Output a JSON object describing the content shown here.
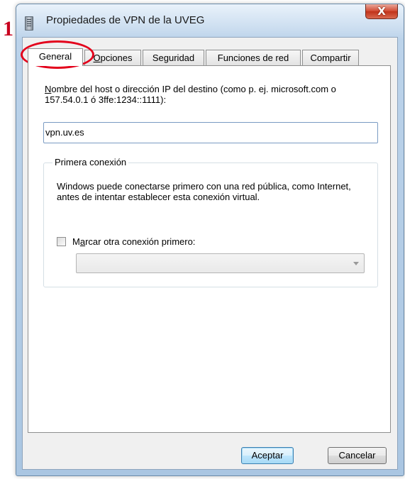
{
  "annotation": {
    "number": "1",
    "color": "#c8001e"
  },
  "window": {
    "title": "Propiedades de VPN de la UVEG",
    "close_glyph": "X"
  },
  "tabs": [
    {
      "label": "General",
      "active": true
    },
    {
      "label_accel": "O",
      "label_rest": "pciones",
      "active": false
    },
    {
      "label": "Seguridad",
      "active": false
    },
    {
      "label": "Funciones de red",
      "active": false
    },
    {
      "label": "Compartir",
      "active": false
    }
  ],
  "general": {
    "host_label_accel": "N",
    "host_label_rest": "ombre del host o dirección IP del destino (como p. ej. microsoft.com o 157.54.0.1 ó 3ffe:1234::1111):",
    "host_value": "vpn.uv.es",
    "group_title": "Primera conexión",
    "group_text": "Windows puede conectarse primero con una red pública, como Internet, antes de intentar establecer esta conexión virtual.",
    "checkbox_accel": "a",
    "checkbox_before": "M",
    "checkbox_after": "rcar otra conexión primero:",
    "checkbox_checked": false,
    "combo_value": ""
  },
  "buttons": {
    "ok": "Aceptar",
    "cancel": "Cancelar"
  }
}
